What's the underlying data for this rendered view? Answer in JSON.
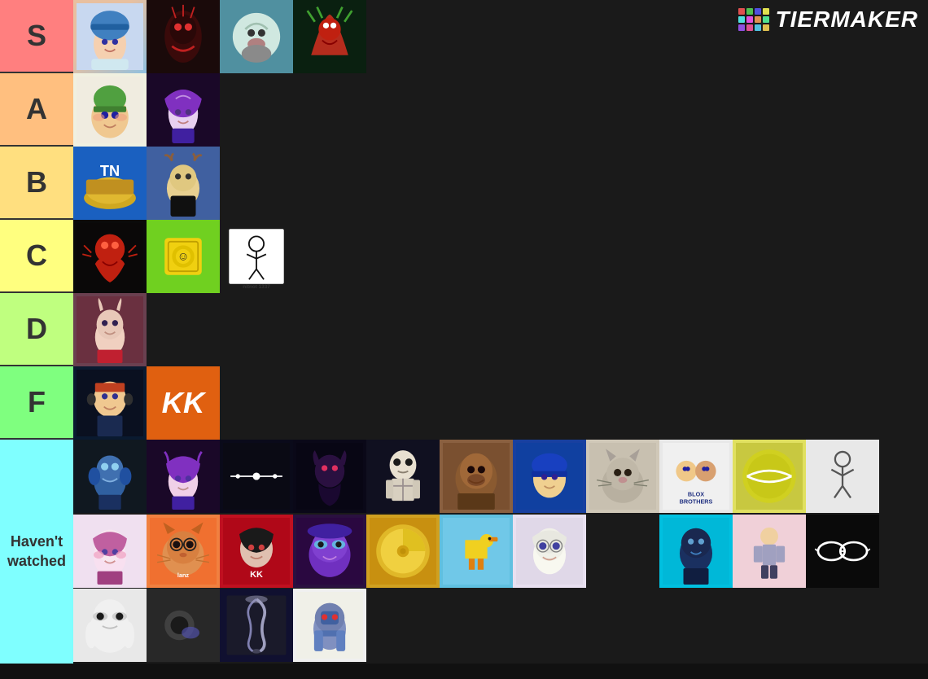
{
  "header": {
    "logo_text": "TiERMAKER"
  },
  "tiers": [
    {
      "label": "S",
      "color": "#ff7f7f"
    },
    {
      "label": "A",
      "color": "#ffbf7f"
    },
    {
      "label": "B",
      "color": "#ffdf7f"
    },
    {
      "label": "C",
      "color": "#ffff7f"
    },
    {
      "label": "D",
      "color": "#bfff7f"
    },
    {
      "label": "F",
      "color": "#7fff7f"
    },
    {
      "label": "Haven't watched",
      "color": "#7fffff"
    }
  ]
}
